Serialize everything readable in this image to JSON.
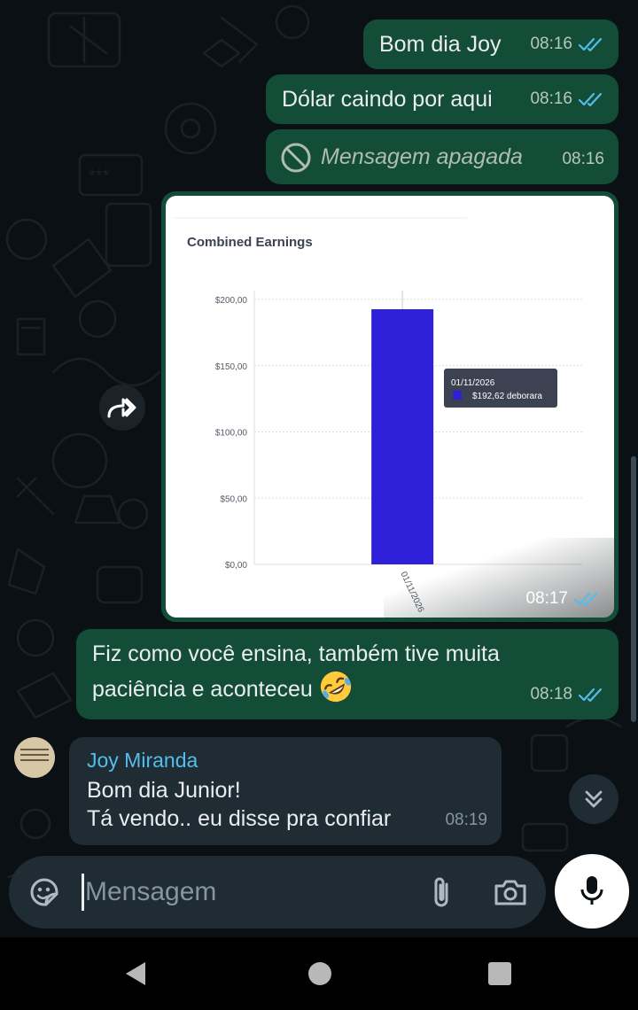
{
  "messages": [
    {
      "text": "Bom dia Joy",
      "time": "08:16",
      "direction": "outgoing",
      "status": "read"
    },
    {
      "text": "Dólar caindo por aqui",
      "time": "08:16",
      "direction": "outgoing",
      "status": "read"
    },
    {
      "text": "Mensagem apagada",
      "time": "08:16",
      "direction": "outgoing",
      "deleted": true
    },
    {
      "type": "image",
      "time": "08:17",
      "direction": "outgoing",
      "status": "read"
    },
    {
      "text": "Fiz como você ensina, também tive muita paciência e aconteceu",
      "emoji": "rolling-on-floor-laughing",
      "time": "08:18",
      "direction": "outgoing",
      "status": "read"
    },
    {
      "sender": "Joy Miranda",
      "line1": "Bom dia Junior!",
      "line2": "Tá vendo.. eu disse pra confiar",
      "time": "08:19",
      "direction": "incoming"
    }
  ],
  "input": {
    "placeholder": "Mensagem"
  },
  "icons": {
    "forward": "forward-icon",
    "scroll": "double-chevron-down-icon",
    "sticker": "sticker-icon",
    "attach": "paperclip-icon",
    "camera": "camera-icon",
    "mic": "microphone-icon",
    "deleted": "block-icon",
    "read": "double-check-icon"
  },
  "colors": {
    "outgoing_bubble": "#144d37",
    "incoming_bubble": "#1f2c34",
    "read_ticks": "#53bdeb",
    "sender_name": "#53bdeb",
    "chart_bar": "#2d20d8"
  },
  "chart_data": {
    "type": "bar",
    "title": "Combined Earnings",
    "categories": [
      "01/11/2026"
    ],
    "series": [
      {
        "name": "deborara",
        "values": [
          192.62
        ]
      }
    ],
    "yticks": [
      "$0,00",
      "$50,00",
      "$100,00",
      "$150,00",
      "$200,00"
    ],
    "ylim": [
      0,
      200
    ],
    "grid": true,
    "tooltip": {
      "date": "01/11/2026",
      "label": "$192,62 deborara"
    }
  }
}
